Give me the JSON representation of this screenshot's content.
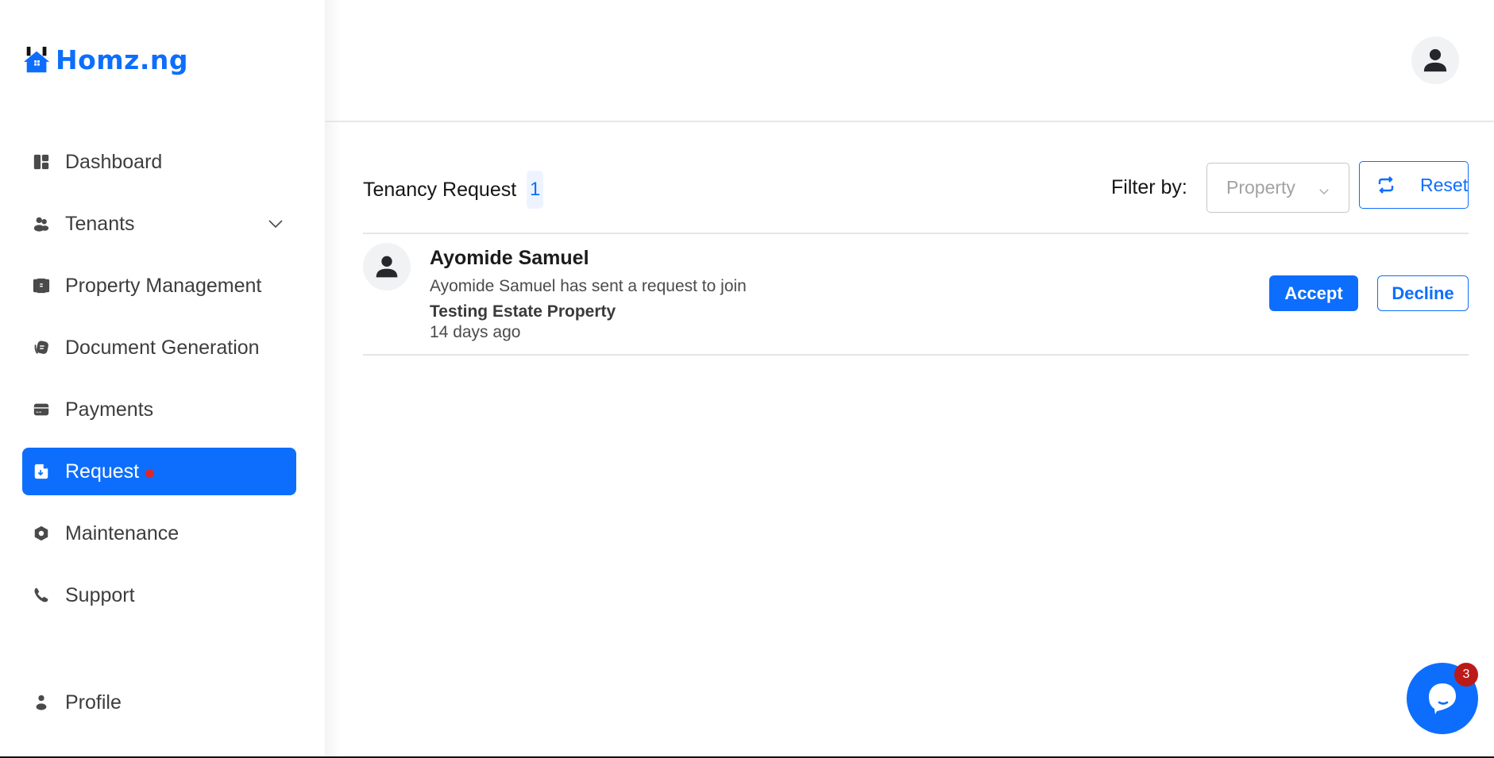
{
  "brand": {
    "name": "Homz.ng",
    "color": "#0d6efd"
  },
  "sidebar": {
    "items": [
      {
        "label": "Dashboard",
        "icon": "dashboard-icon",
        "active": false
      },
      {
        "label": "Tenants",
        "icon": "users-icon",
        "active": false,
        "expandable": true
      },
      {
        "label": "Property Management",
        "icon": "building-icon",
        "active": false
      },
      {
        "label": "Document Generation",
        "icon": "document-icon",
        "active": false
      },
      {
        "label": "Payments",
        "icon": "card-icon",
        "active": false
      },
      {
        "label": "Request",
        "icon": "file-download-icon",
        "active": true,
        "has_notification_dot": true
      },
      {
        "label": "Maintenance",
        "icon": "nut-icon",
        "active": false
      },
      {
        "label": "Support",
        "icon": "phone-icon",
        "active": false
      },
      {
        "label": "Profile",
        "icon": "person-icon",
        "active": false
      }
    ]
  },
  "header": {
    "avatar_icon": "user-avatar-icon"
  },
  "main": {
    "title": "Tenancy Request",
    "count": "1",
    "filter": {
      "label": "Filter by:",
      "select_placeholder": "Property",
      "reset_label": "Reset"
    },
    "requests": [
      {
        "name": "Ayomide Samuel",
        "message_prefix": "Ayomide Samuel has sent a request to join",
        "property": "Testing Estate Property",
        "time": "14 days ago",
        "accept_label": "Accept",
        "decline_label": "Decline"
      }
    ]
  },
  "chat_widget": {
    "unread_count": "3"
  },
  "colors": {
    "accent": "#0d6efd",
    "notification": "#e0262b",
    "chat_badge": "#bb1a1a"
  }
}
